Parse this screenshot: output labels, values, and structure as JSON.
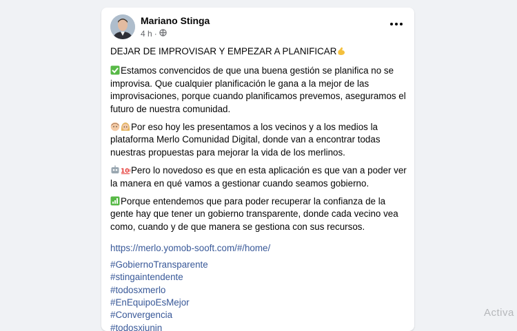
{
  "post": {
    "author": "Mariano Stinga",
    "time": "4 h",
    "separator": "·",
    "title": "DEJAR DE IMPROVISAR Y EMPEZAR A PLANIFICAR",
    "paragraphs": [
      "Estamos convencidos de que una buena gestión se planifica no se improvisa. Que cualquier planificación le gana a la mejor de las improvisaciones, porque cuando planificamos prevemos, aseguramos el futuro de nuestra comunidad.",
      "Por eso hoy les presentamos a los vecinos y a los medios la plataforma Merlo Comunidad Digital, donde van a encontrar todas nuestras propuestas para mejorar la vida de los merlinos.",
      "Pero lo novedoso es que en esta aplicación es que van a poder ver la manera en qué vamos a gestionar cuando seamos gobierno.",
      "Porque entendemos que para poder recuperar la confianza de la gente hay que tener un gobierno transparente, donde cada vecino vea como, cuando y de que manera se gestiona con sus recursos."
    ],
    "link": "https://merlo.yomob-sooft.com/#/home/",
    "hashtags": [
      "#GobiernoTransparente",
      "#stingaintendente",
      "#todosxmerlo",
      "#EnEquipoEsMejor",
      "#Convergencia",
      "#todosxjunin"
    ]
  },
  "overlay": {
    "watermark": "Activa"
  },
  "icons": {
    "more": "more-options-icon",
    "privacy": "globe-icon",
    "emojis": [
      "flexed-biceps-emoji",
      "check-mark-emoji",
      "man-emoji",
      "woman-emoji",
      "robot-emoji",
      "hundred-points-emoji",
      "chart-emoji"
    ]
  },
  "colors": {
    "link": "#385898",
    "text": "#050505",
    "secondary": "#65676b",
    "background": "#f0f2f5",
    "check": "#58b947"
  }
}
